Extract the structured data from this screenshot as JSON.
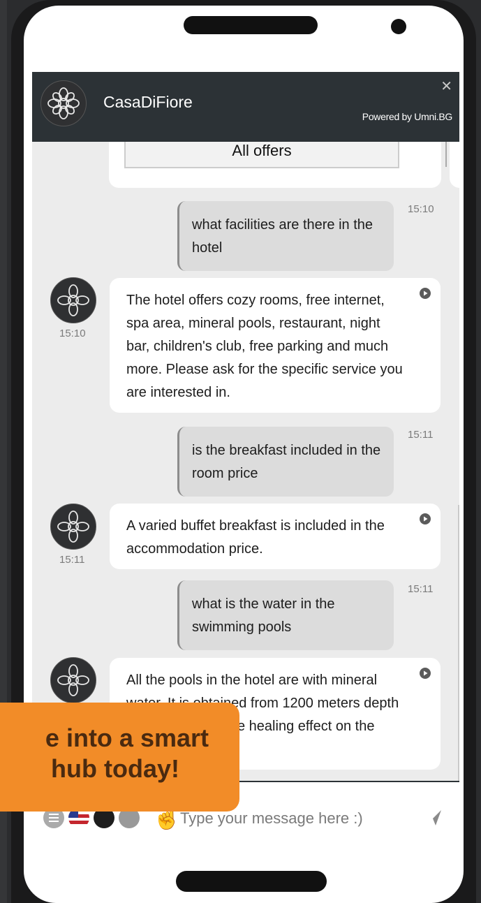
{
  "header": {
    "title": "CasaDiFiore",
    "powered_by": "Powered by Umni.BG",
    "close_label": "✕"
  },
  "offers": {
    "button_label": "All offers"
  },
  "messages": [
    {
      "from": "user",
      "text": "what facilities are there in the hotel",
      "time": "15:10"
    },
    {
      "from": "bot",
      "text": "The hotel offers cozy rooms, free internet, spa area, mineral pools, restaurant, night bar, children's club, free parking and much more. Please ask for the specific service you are interested in.",
      "time": "15:10"
    },
    {
      "from": "user",
      "text": "is the breakfast included in the room price",
      "time": "15:11"
    },
    {
      "from": "bot",
      "text": "A varied buffet breakfast is included in the accommodation price.",
      "time": "15:11"
    },
    {
      "from": "user",
      "text": "what is the water in the swimming pools",
      "time": "15:11"
    },
    {
      "from": "bot",
      "text": "All the pools in the hotel are with mineral water. It is obtained from 1200 meters depth and has favourable healing effect on the human body.",
      "time": ""
    }
  ],
  "input": {
    "placeholder": "Type your message here :)"
  },
  "promo": {
    "line1": "e into a smart",
    "line2": "hub today!"
  },
  "icons": {
    "logo": "flower-logo-icon",
    "play": "play-icon",
    "send": "send-icon",
    "menu": "menu-icon",
    "language": "us-flag-icon",
    "cursor": "hand-pointer-icon"
  },
  "colors": {
    "header_bg": "#2c3236",
    "chat_bg": "#ececec",
    "user_bubble": "#dcdcdc",
    "bot_bubble": "#ffffff",
    "promo_bg": "#f28c28"
  }
}
